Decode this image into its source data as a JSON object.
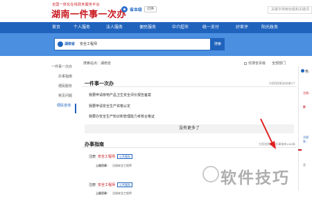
{
  "header": {
    "logo_sub": "全国一体化在线政务服务平台",
    "logo_main": "湖南一件事一次办",
    "level": "省本级",
    "switch": "切换",
    "search_placeholder": "关键字搜索标题和关键词"
  },
  "nav": [
    "首页",
    "个人服务",
    "法人服务",
    "便民服务",
    "中介超市",
    "统一支付",
    "好差评",
    "阳光政务"
  ],
  "banner": {
    "region": "湖南省",
    "query": "安全工程师",
    "button": "搜索"
  },
  "sidebar": [
    "一件事一次办",
    "办事指南",
    "便民服务",
    "常见问题",
    "便民咨询"
  ],
  "main": {
    "location": "搜索站点：湖南省",
    "checkbox_label": "仅搜省本级",
    "dept": "全部部门",
    "sec1": {
      "title": "一件事一次办",
      "count": "为您找到相关结果3个",
      "items": [
        "我要申请核电产品卫生安全评价报告备案",
        "我要申请安全生产资格认定",
        "我要办安全生产知识和管理能力考核合格证"
      ],
      "more": "没有更多了"
    },
    "sec2": {
      "title": "办事指南",
      "count": "为您找到相关办事指南1089条",
      "items": [
        {
          "prefix": "注册",
          "hl": "安全工程师",
          "tag": "公共服务",
          "label": "上级目录：",
          "val": "注册安全工程师"
        },
        {
          "prefix": "注册",
          "hl": "安全工程师",
          "tag": "公共服务",
          "label": "上级目录：",
          "val": "注册安全工程师"
        }
      ]
    }
  },
  "right": {
    "t1": "热",
    "t2": "注册...",
    "t3": "办",
    "t4": "注册安...",
    "t5": "注"
  },
  "watermark": "软件技巧"
}
